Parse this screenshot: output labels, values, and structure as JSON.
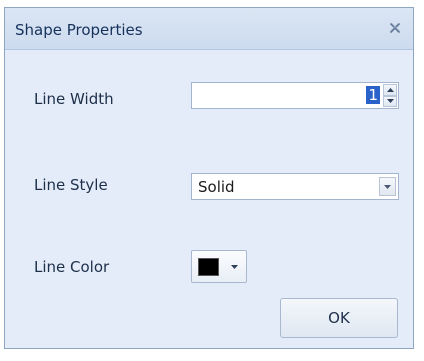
{
  "window": {
    "title": "Shape Properties",
    "close_icon": "close-icon"
  },
  "form": {
    "line_width": {
      "label": "Line Width",
      "value": "1"
    },
    "line_style": {
      "label": "Line Style",
      "value": "Solid"
    },
    "line_color": {
      "label": "Line Color",
      "value": "#000000"
    }
  },
  "buttons": {
    "ok_label": "OK"
  },
  "colors": {
    "dialog_bg": "#e3ecf8",
    "titlebar_bg": "#cddbef",
    "selection": "#2a62c9"
  }
}
